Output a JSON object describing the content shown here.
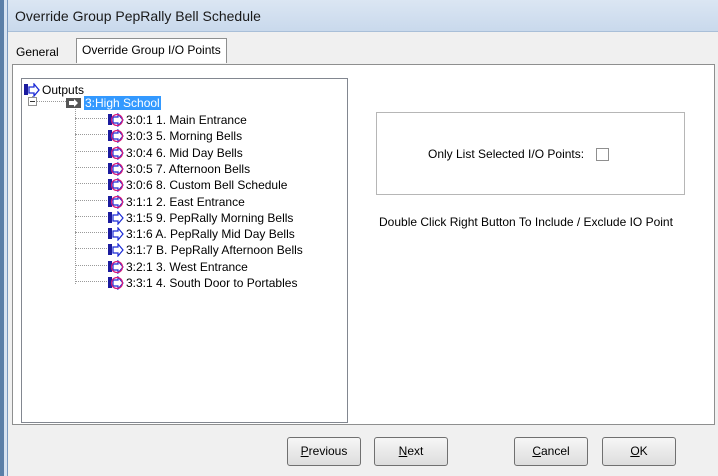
{
  "window": {
    "title": "Override Group PepRally Bell Schedule"
  },
  "tabs": [
    {
      "label": "General",
      "active": false
    },
    {
      "label": "Override Group I/O Points",
      "active": true
    }
  ],
  "tree": {
    "root_label": "Outputs",
    "group": {
      "label": "3:High School",
      "selected": true
    },
    "items": [
      {
        "label": "3:0:1  1. Main Entrance",
        "icon": "bell-output-icon"
      },
      {
        "label": "3:0:3  5. Morning Bells",
        "icon": "bell-output-icon"
      },
      {
        "label": "3:0:4  6. Mid Day Bells",
        "icon": "bell-output-icon"
      },
      {
        "label": "3:0:5  7. Afternoon Bells",
        "icon": "bell-output-icon"
      },
      {
        "label": "3:0:6  8. Custom Bell Schedule",
        "icon": "bell-output-icon"
      },
      {
        "label": "3:1:1  2. East Entrance",
        "icon": "bell-output-icon"
      },
      {
        "label": "3:1:5  9. PepRally Morning Bells",
        "icon": "included-output-icon"
      },
      {
        "label": "3:1:6  A. PepRally Mid Day Bells",
        "icon": "included-output-icon"
      },
      {
        "label": "3:1:7  B. PepRally Afternoon Bells",
        "icon": "included-output-icon"
      },
      {
        "label": "3:2:1  3. West Entrance",
        "icon": "bell-output-icon"
      },
      {
        "label": "3:3:1  4. South Door to Portables",
        "icon": "bell-output-icon"
      }
    ]
  },
  "filter": {
    "label": "Only List Selected I/O Points:",
    "checked": false
  },
  "hint": "Double Click Right Button To Include / Exclude IO Point",
  "buttons": {
    "previous": {
      "key": "P",
      "rest": "revious"
    },
    "next": {
      "key": "N",
      "rest": "ext"
    },
    "cancel": {
      "key": "C",
      "rest": "ancel"
    },
    "ok": {
      "key": "O",
      "rest": "K"
    }
  },
  "colors": {
    "selection": "#3399ff",
    "icon_blue": "#1b2bd6",
    "icon_red": "#d61b7a"
  }
}
